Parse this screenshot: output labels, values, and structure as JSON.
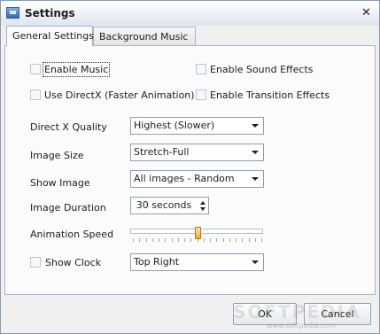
{
  "window": {
    "title": "Settings",
    "close_symbol": "✕"
  },
  "tabs": [
    {
      "label": "General Settings",
      "active": true
    },
    {
      "label": "Background Music",
      "active": false
    }
  ],
  "checkboxes": {
    "enable_music": {
      "label": "Enable Music",
      "checked": false
    },
    "enable_sound_effects": {
      "label": "Enable Sound Effects",
      "checked": false
    },
    "use_directx": {
      "label": "Use DirectX (Faster Animation)",
      "checked": false
    },
    "enable_transition_effects": {
      "label": "Enable Transition Effects",
      "checked": false
    }
  },
  "fields": {
    "directx_quality": {
      "label": "Direct X Quality",
      "value": "Highest (Slower)"
    },
    "image_size": {
      "label": "Image Size",
      "value": "Stretch-Full"
    },
    "show_image": {
      "label": "Show Image",
      "value": "All images - Random"
    },
    "image_duration": {
      "label": "Image Duration",
      "value": "30 seconds"
    },
    "animation_speed": {
      "label": "Animation Speed",
      "value_fraction": 0.5,
      "ticks": 21
    },
    "show_clock": {
      "label": "Show Clock",
      "checked": false,
      "value": "Top Right"
    }
  },
  "buttons": {
    "ok": "OK",
    "cancel": "Cancel"
  },
  "watermark": {
    "main": "SOFTPEDIA",
    "url": "www.softpedia.com"
  }
}
